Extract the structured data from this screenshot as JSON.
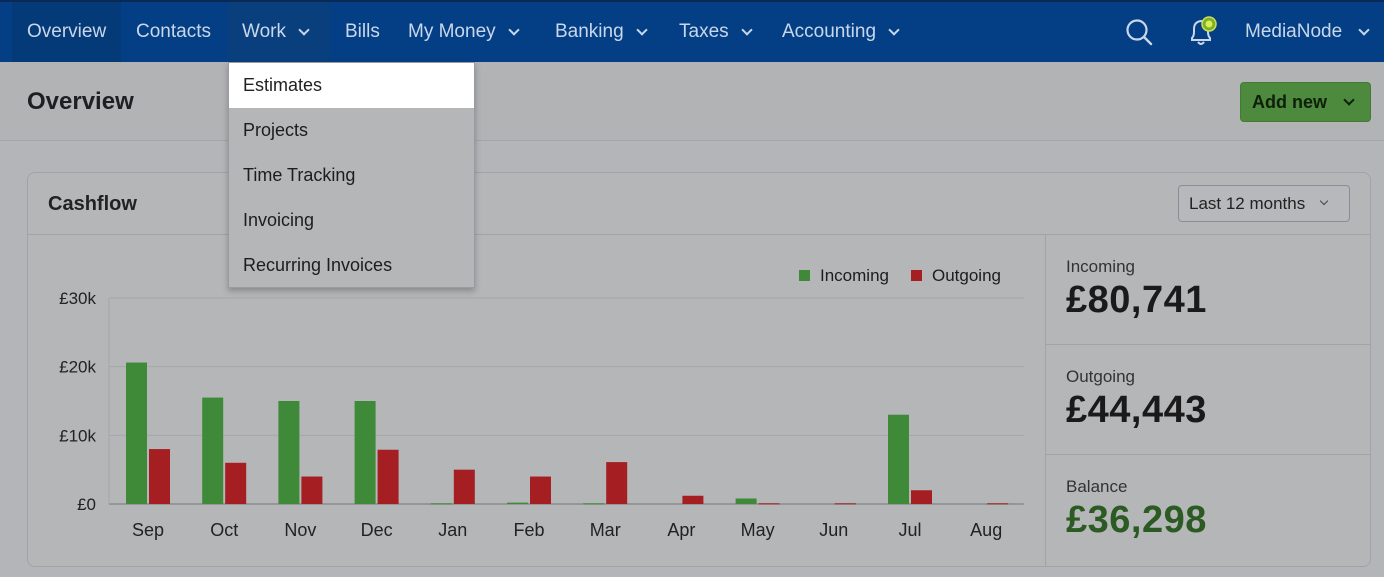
{
  "nav": {
    "items": [
      {
        "label": "Overview"
      },
      {
        "label": "Contacts"
      },
      {
        "label": "Work"
      },
      {
        "label": "Bills"
      },
      {
        "label": "My Money"
      },
      {
        "label": "Banking"
      },
      {
        "label": "Taxes"
      },
      {
        "label": "Accounting"
      }
    ],
    "account": "MediaNode"
  },
  "work_menu": {
    "items": [
      "Estimates",
      "Projects",
      "Time Tracking",
      "Invoicing",
      "Recurring Invoices"
    ]
  },
  "header": {
    "title": "Overview",
    "add_new_label": "Add new"
  },
  "cashflow": {
    "title": "Cashflow",
    "period": "Last 12 months",
    "stats": {
      "incoming_label": "Incoming",
      "incoming_value": "£80,741",
      "outgoing_label": "Outgoing",
      "outgoing_value": "£44,443",
      "balance_label": "Balance",
      "balance_value": "£36,298"
    }
  },
  "colors": {
    "incoming": "#3f8a38",
    "outgoing": "#a51e22",
    "nav_bg": "#043f85",
    "add_new": "#4d8a3d"
  },
  "chart_data": {
    "type": "bar",
    "categories": [
      "Sep",
      "Oct",
      "Nov",
      "Dec",
      "Jan",
      "Feb",
      "Mar",
      "Apr",
      "May",
      "Jun",
      "Jul",
      "Aug"
    ],
    "series": [
      {
        "name": "Incoming",
        "values": [
          20600,
          15500,
          15000,
          15000,
          100,
          200,
          100,
          0,
          800,
          0,
          13000,
          0
        ]
      },
      {
        "name": "Outgoing",
        "values": [
          8000,
          6000,
          4000,
          7900,
          5000,
          4000,
          6100,
          1200,
          100,
          100,
          2000,
          100
        ]
      }
    ],
    "yticks": [
      "£0",
      "£10k",
      "£20k",
      "£30k"
    ],
    "ytick_values": [
      0,
      10000,
      20000,
      30000
    ],
    "ylim": [
      0,
      30000
    ],
    "legend_position": "top-right",
    "grid": true
  }
}
